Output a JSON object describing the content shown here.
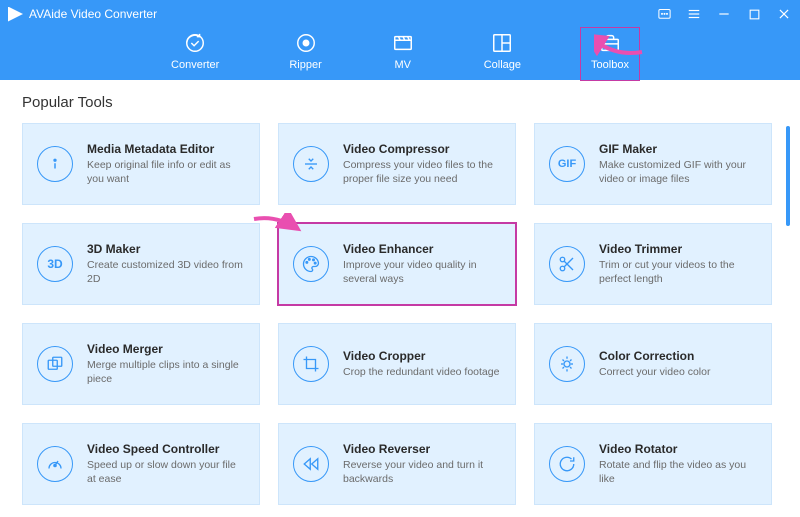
{
  "app": {
    "title": "AVAide Video Converter"
  },
  "nav": {
    "converter": "Converter",
    "ripper": "Ripper",
    "mv": "MV",
    "collage": "Collage",
    "toolbox": "Toolbox"
  },
  "section": {
    "title": "Popular Tools"
  },
  "tools": {
    "metadata": {
      "title": "Media Metadata Editor",
      "desc": "Keep original file info or edit as you want"
    },
    "compressor": {
      "title": "Video Compressor",
      "desc": "Compress your video files to the proper file size you need"
    },
    "gif": {
      "title": "GIF Maker",
      "desc": "Make customized GIF with your video or image files"
    },
    "3d": {
      "title": "3D Maker",
      "desc": "Create customized 3D video from 2D"
    },
    "enhancer": {
      "title": "Video Enhancer",
      "desc": "Improve your video quality in several ways"
    },
    "trimmer": {
      "title": "Video Trimmer",
      "desc": "Trim or cut your videos to the perfect length"
    },
    "merger": {
      "title": "Video Merger",
      "desc": "Merge multiple clips into a single piece"
    },
    "cropper": {
      "title": "Video Cropper",
      "desc": "Crop the redundant video footage"
    },
    "color": {
      "title": "Color Correction",
      "desc": "Correct your video color"
    },
    "speed": {
      "title": "Video Speed Controller",
      "desc": "Speed up or slow down your file at ease"
    },
    "reverser": {
      "title": "Video Reverser",
      "desc": "Reverse your video and turn it backwards"
    },
    "rotator": {
      "title": "Video Rotator",
      "desc": "Rotate and flip the video as you like"
    }
  }
}
